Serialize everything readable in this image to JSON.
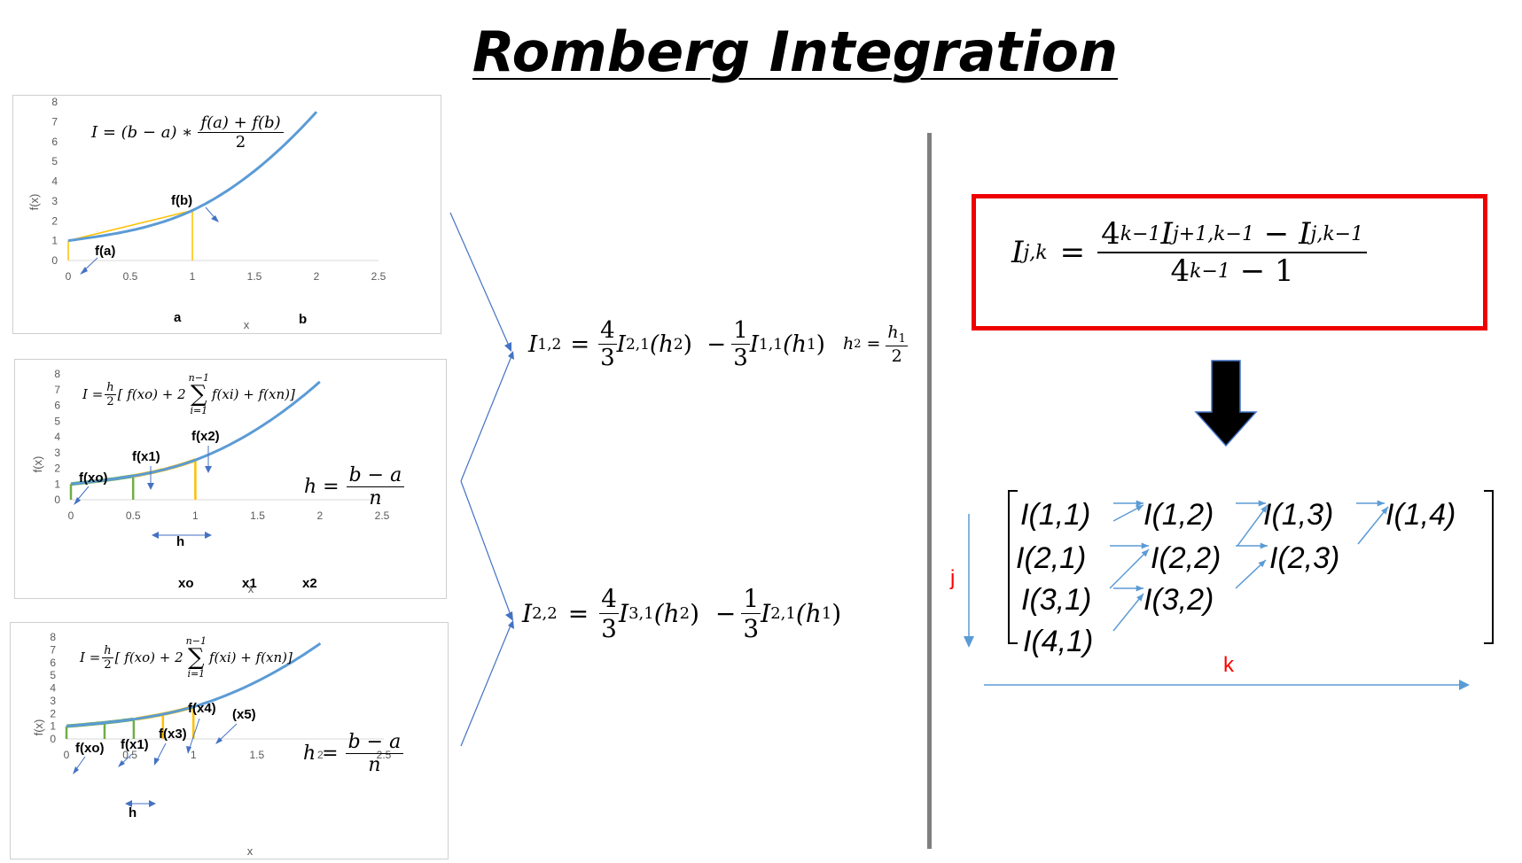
{
  "title": "Romberg Integration",
  "colors": {
    "curve": "#5b9bd5",
    "yellow": "#ffc000",
    "green": "#70ad47",
    "arrow": "#4472c4",
    "red": "#ff0000",
    "axis": "#595959"
  },
  "charts": [
    {
      "ylabel": "f(x)",
      "xlabel": "x",
      "yticks": [
        "0",
        "1",
        "2",
        "3",
        "4",
        "5",
        "6",
        "7",
        "8"
      ],
      "xticks": [
        "0",
        "0.5",
        "1",
        "1.5",
        "2",
        "2.5"
      ],
      "formula": {
        "lhs": "I = (b − a) ∗",
        "num": "f(a) + f(b)",
        "den": "2"
      },
      "labels": {
        "fa": "f(a)",
        "fb": "f(b)",
        "a": "a",
        "b": "b"
      }
    },
    {
      "ylabel": "f(x)",
      "xlabel": "x",
      "yticks": [
        "0",
        "1",
        "2",
        "3",
        "4",
        "5",
        "6",
        "7",
        "8"
      ],
      "xticks": [
        "0",
        "0.5",
        "1",
        "1.5",
        "2",
        "2.5"
      ],
      "formula": {
        "pre": "I =",
        "h": "h",
        "two": "2",
        "body1": "[ f(xo) + 2",
        "sum_top": "n−1",
        "sum_bot": "i=1",
        "body2": "f(xi) + f(xn)]"
      },
      "h_formula": {
        "lhs": "h =",
        "num": "b − a",
        "den": "n"
      },
      "labels": {
        "fxo": "f(xo)",
        "fx1": "f(x1)",
        "fx2": "f(x2)",
        "h": "h",
        "xo": "xo",
        "x1": "x1",
        "x2": "x2"
      }
    },
    {
      "ylabel": "f(x)",
      "xlabel": "x",
      "yticks": [
        "0",
        "1",
        "2",
        "3",
        "4",
        "5",
        "6",
        "7",
        "8"
      ],
      "xticks": [
        "0",
        "0.5",
        "1",
        "1.5",
        "2",
        "2.5"
      ],
      "formula": {
        "pre": "I =",
        "h": "h",
        "two": "2",
        "body1": "[ f(xo) + 2",
        "sum_top": "n−1",
        "sum_bot": "i=1",
        "body2": "f(xi) + f(xn)]"
      },
      "h_formula": {
        "lhs": "h =",
        "num": "b − a",
        "den": "n"
      },
      "labels": {
        "fxo": "f(xo)",
        "fx1": "f(x1)",
        "fx3": "f(x3)",
        "fx4": "f(x4)",
        "x5": "(x5)",
        "h": "h"
      }
    }
  ],
  "eq1": {
    "lhs": "I",
    "lhs_sub": "1,2",
    "eq": "=",
    "n1": "4",
    "d1": "3",
    "t1": "I",
    "t1_sub": "2,1",
    "t1_arg": "(h",
    "t1_arg_sub": "2",
    "minus": ")  −",
    "n2": "1",
    "d2": "3",
    "t2": "I",
    "t2_sub": "1,1",
    "t2_arg": "(h",
    "t2_arg_sub": "1",
    "close": ")",
    "h2": "h",
    "h2_sub": "2",
    "h2_eq": "=",
    "h1n": "h",
    "h1n_sub": "1",
    "h1d": "2"
  },
  "eq2": {
    "lhs": "I",
    "lhs_sub": "2,2",
    "eq": "=",
    "n1": "4",
    "d1": "3",
    "t1": "I",
    "t1_sub": "3,1",
    "t1_arg": "(h",
    "t1_arg_sub": "2",
    "minus": ")  −",
    "n2": "1",
    "d2": "3",
    "t2": "I",
    "t2_sub": "2,1",
    "t2_arg": "(h",
    "t2_arg_sub": "1",
    "close": ")"
  },
  "main_formula": {
    "lhs": "I",
    "lhs_sub": "j,k",
    "eq": "=",
    "num_base": "4",
    "num_exp": "k−1",
    "num_i1": "I",
    "num_i1_sub": "j+1,k−1",
    "num_minus": " − ",
    "num_i2": "I",
    "num_i2_sub": "j,k−1",
    "den_base": "4",
    "den_exp": "k−1",
    "den_rest": " − 1"
  },
  "matrix": {
    "rows": [
      [
        "I(1,1)",
        "I(1,2)",
        "I(1,3)",
        "I(1,4)"
      ],
      [
        "I(2,1)",
        "I(2,2)",
        "I(2,3)"
      ],
      [
        "I(3,1)",
        "I(3,2)"
      ],
      [
        "I(4,1)"
      ]
    ],
    "j_label": "j",
    "k_label": "k"
  }
}
